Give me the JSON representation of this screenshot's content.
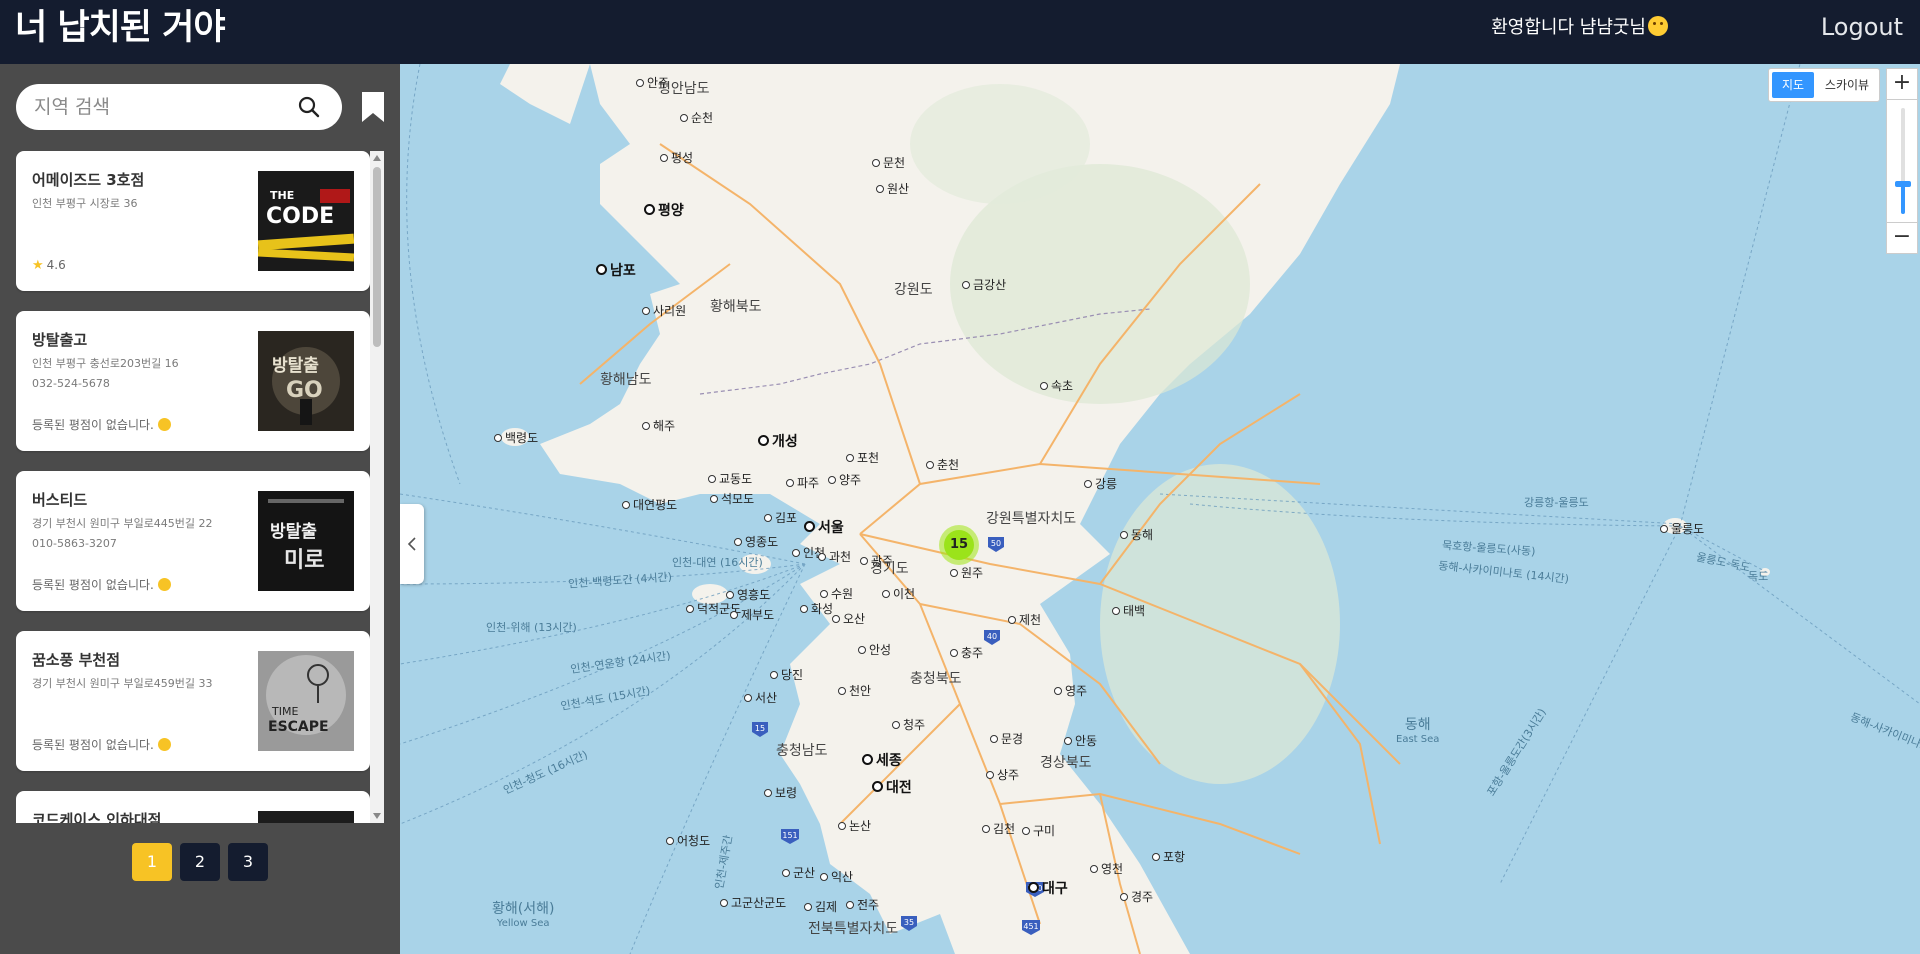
{
  "header": {
    "logo": "너 납치된 거야",
    "welcome": "환영합니다 냠냠굿님",
    "logout": "Logout"
  },
  "sidebar": {
    "search_placeholder": "지역 검색",
    "cards": [
      {
        "name": "어메이즈드 3호점",
        "address": "인천 부평구 시장로 36",
        "phone": "",
        "rating": "4.6",
        "has_rating": true,
        "thumb_text": "THE CODE"
      },
      {
        "name": "방탈출고",
        "address": "인천 부평구 충선로203번길 16",
        "phone": "032-524-5678",
        "rating": "등록된 평점이 없습니다.",
        "has_rating": false,
        "thumb_text": "방탈출 GO"
      },
      {
        "name": "버스티드",
        "address": "경기 부천시 원미구 부일로445번길 22",
        "phone": "010-5863-3207",
        "rating": "등록된 평점이 없습니다.",
        "has_rating": false,
        "thumb_text": "방탈출 미로"
      },
      {
        "name": "꿈소풍 부천점",
        "address": "경기 부천시 원미구 부일로459번길 33",
        "phone": "",
        "rating": "등록된 평점이 없습니다.",
        "has_rating": false,
        "thumb_text": "TIME ESCAPE"
      },
      {
        "name": "코드케이스 인하대점",
        "address": "",
        "phone": "",
        "rating": "",
        "has_rating": false,
        "thumb_text": ""
      }
    ],
    "pages": [
      "1",
      "2",
      "3"
    ],
    "active_page": "1"
  },
  "map": {
    "maptype": {
      "map": "지도",
      "skyview": "스카이뷰",
      "active": "지도"
    },
    "zoom": {
      "plus": "+",
      "minus": "−",
      "level_fraction": 0.72
    },
    "cluster_count": "15",
    "labels": {
      "pyeongannamdo": "평안남도",
      "anju": "안주",
      "suncheon": "순천",
      "pyeongseong": "평성",
      "munchon": "문천",
      "wonsan": "원산",
      "pyongyang": "평양",
      "nampo": "남포",
      "sariwon": "사리원",
      "hwanghaebukdo": "황해북도",
      "gangwondo_n": "강원도",
      "geumgangsan": "금강산",
      "hwanghaenamdo": "황해남도",
      "sokcho": "속초",
      "haeju": "해주",
      "kaesong": "개성",
      "baengnyeongdo": "백령도",
      "pocheon": "포천",
      "yangju": "양주",
      "chuncheon": "춘천",
      "gangneung": "강릉",
      "paju": "파주",
      "gyodongdo": "교동도",
      "seokmodo": "석모도",
      "gimpo": "김포",
      "seoul": "서울",
      "gangwonspecial": "강원특별자치도",
      "yeonpyeongdo": "대연평도",
      "yeongjongdo": "영종도",
      "incheon": "인천",
      "gwacheon": "과천",
      "gwangju_g": "광주",
      "gyeonggido": "경기도",
      "wonju": "원주",
      "donghae": "동해",
      "suwon": "수원",
      "icheon": "이천",
      "ulleungdo": "울릉도",
      "dokdo": "독도",
      "yeongheungdo": "영흥도",
      "hwaseong": "화성",
      "deokjeokgundo": "덕적군도",
      "jebudo": "제부도",
      "osan": "오산",
      "jecheon": "제천",
      "taebaek": "태백",
      "anseong": "안성",
      "chungju": "충주",
      "dangjin": "당진",
      "chungcheongbukdo": "충청북도",
      "cheonan": "천안",
      "yeongju": "영주",
      "seosan": "서산",
      "donghae_sea": "동해",
      "east_sea": "East Sea",
      "cheongju": "청주",
      "mungyeong": "문경",
      "andong": "안동",
      "chungcheongnamdo": "충청남도",
      "sejong": "세종",
      "gyeongsangbukdo": "경상북도",
      "daejeon": "대전",
      "sangju": "상주",
      "boryeong": "보령",
      "nonsan": "논산",
      "gimcheon": "김천",
      "gumi": "구미",
      "eocheongdo": "어청도",
      "pohang": "포항",
      "gunsan": "군산",
      "iksan": "익산",
      "yeongcheon": "영천",
      "gogunsangundo": "고군산군도",
      "gimje": "김제",
      "jeonju": "전주",
      "daegu": "대구",
      "gyeongju": "경주",
      "yellowsea": "황해(서해)",
      "yellow_sea": "Yellow Sea",
      "jeonbuk": "전북특별자치도"
    },
    "ferry_routes": {
      "incheon_daeyeon": "인천-대연 (16시간)",
      "incheon_baengnyeong": "인천-백령도간 (4시간)",
      "incheon_weihai": "인천-위해 (13시간)",
      "incheon_yeontai": "인천-연운항 (24시간)",
      "incheon_seokdo": "인천-석도 (15시간)",
      "incheon_qingdao": "인천-청도 (16시간)",
      "gangneung_ulleung": "강릉항-울릉도",
      "mukho_ulleung": "묵호항-울릉도(사동)",
      "donghae_sakai": "동해-사카이미나토 (14시간)",
      "ulleung_dokdo": "울릉도-독도",
      "pohang_ulleung": "포항-울릉도간(3시간)",
      "donghae_sakai2": "동해-사카이미나토",
      "incheon_jeju": "인천-제주간"
    },
    "road_shields": [
      "50",
      "40",
      "15",
      "151",
      "35",
      "700",
      "451"
    ]
  }
}
